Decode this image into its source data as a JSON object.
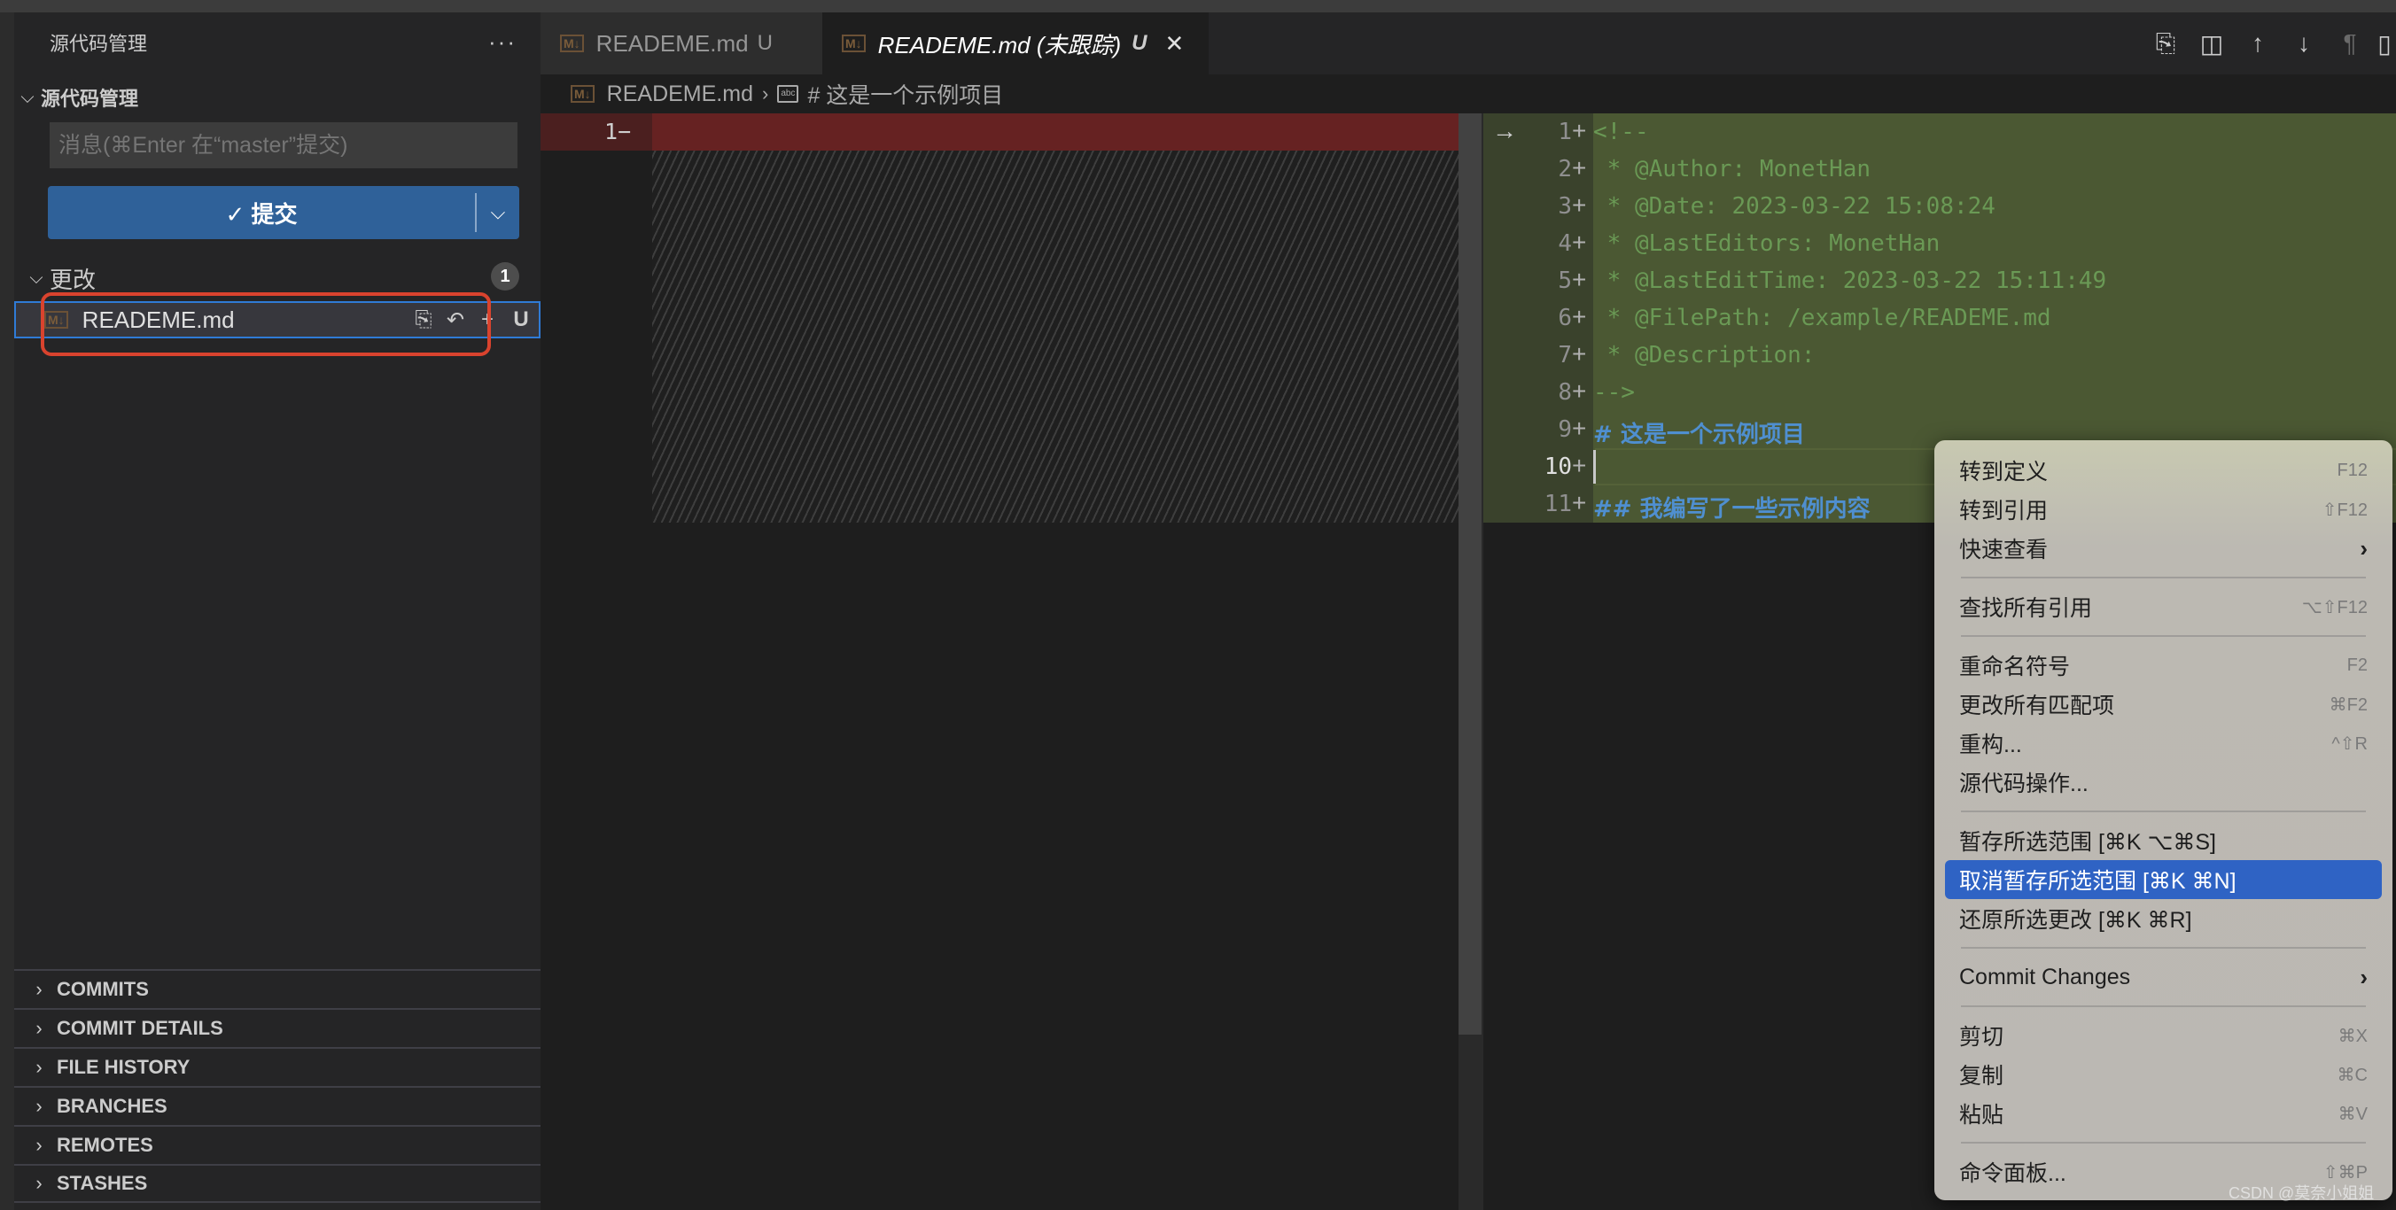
{
  "sidebar": {
    "title": "源代码管理",
    "more_icon": "ellipsis-icon",
    "section_title": "源代码管理",
    "commit_message_placeholder": "消息(⌘Enter 在“master”提交)",
    "commit_button_label": "✓ 提交",
    "changes_label": "更改",
    "changes_count": "1",
    "changed_files": [
      {
        "name": "READEME.md",
        "status": "U",
        "icon": "markdown-icon"
      }
    ],
    "file_actions": [
      "open-file-icon",
      "discard-changes-icon",
      "stage-changes-icon"
    ],
    "panels": [
      "COMMITS",
      "COMMIT DETAILS",
      "FILE HISTORY",
      "BRANCHES",
      "REMOTES",
      "STASHES"
    ]
  },
  "tabs": [
    {
      "label": "READEME.md",
      "status": "U",
      "active": false
    },
    {
      "label": "READEME.md (未跟踪)",
      "status": "U",
      "active": true
    }
  ],
  "toolbar_icons": [
    "open-file-icon",
    "split-find-icon",
    "arrow-up-icon",
    "arrow-down-icon",
    "pilcrow-icon",
    "split-editor-icon"
  ],
  "breadcrumb": {
    "file": "READEME.md",
    "symbol": "# 这是一个示例项目"
  },
  "diff": {
    "left": [
      {
        "num": "1",
        "marker": "−",
        "text": ""
      }
    ],
    "right": [
      {
        "num": "1",
        "text": "<!--"
      },
      {
        "num": "2",
        "text": " * @Author: MonetHan"
      },
      {
        "num": "3",
        "text": " * @Date: 2023-03-22 15:08:24"
      },
      {
        "num": "4",
        "text": " * @LastEditors: MonetHan"
      },
      {
        "num": "5",
        "text": " * @LastEditTime: 2023-03-22 15:11:49"
      },
      {
        "num": "6",
        "text": " * @FilePath: /example/READEME.md"
      },
      {
        "num": "7",
        "text": " * @Description:"
      },
      {
        "num": "8",
        "text": "-->"
      },
      {
        "num": "9",
        "text": "# 这是一个示例项目"
      },
      {
        "num": "10",
        "text": ""
      },
      {
        "num": "11",
        "text": "## 我编写了一些示例内容"
      }
    ]
  },
  "context_menu": {
    "groups": [
      [
        {
          "label": "转到定义",
          "shortcut": "F12"
        },
        {
          "label": "转到引用",
          "shortcut": "⇧F12"
        },
        {
          "label": "快速查看",
          "submenu": true
        }
      ],
      [
        {
          "label": "查找所有引用",
          "shortcut": "⌥⇧F12"
        }
      ],
      [
        {
          "label": "重命名符号",
          "shortcut": "F2"
        },
        {
          "label": "更改所有匹配项",
          "shortcut": "⌘F2"
        },
        {
          "label": "重构...",
          "shortcut": "^⇧R"
        },
        {
          "label": "源代码操作..."
        }
      ],
      [
        {
          "label": "暂存所选范围 [⌘K ⌥⌘S]"
        },
        {
          "label": "取消暂存所选范围 [⌘K ⌘N]",
          "selected": true
        },
        {
          "label": "还原所选更改 [⌘K ⌘R]"
        }
      ],
      [
        {
          "label": "Commit Changes",
          "submenu": true
        }
      ],
      [
        {
          "label": "剪切",
          "shortcut": "⌘X"
        },
        {
          "label": "复制",
          "shortcut": "⌘C"
        },
        {
          "label": "粘贴",
          "shortcut": "⌘V"
        }
      ],
      [
        {
          "label": "命令面板...",
          "shortcut": "⇧⌘P"
        }
      ]
    ]
  },
  "watermark": "CSDN @莫奈小姐姐"
}
